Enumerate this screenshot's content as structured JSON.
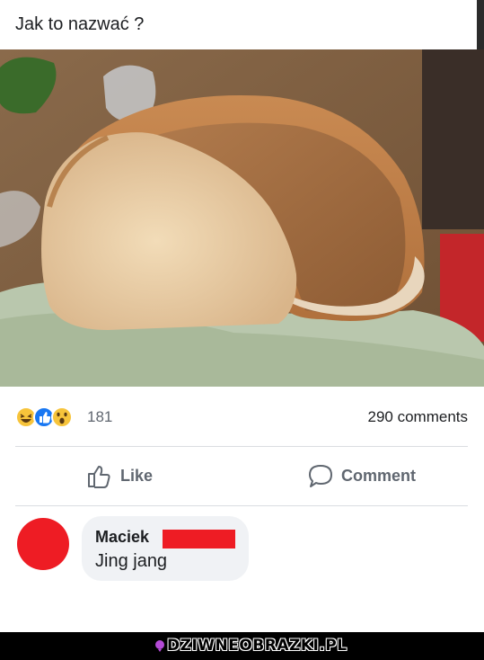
{
  "post": {
    "text": "Jak to nazwać ?"
  },
  "photo": {
    "icon": "bread-loaf-photo"
  },
  "stats": {
    "reactions_count": "181",
    "comments_count": "290 comments",
    "reaction_icons": [
      "haha-icon",
      "like-icon",
      "wow-icon"
    ]
  },
  "actions": {
    "like_label": "Like",
    "comment_label": "Comment"
  },
  "comment": {
    "author": "Maciek",
    "text": "Jing jang"
  },
  "watermark": {
    "text": "DZIWNEOBRAZKI.PL"
  },
  "colors": {
    "redaction": "#ee1c24",
    "like_blue": "#1877f2",
    "reaction_yellow": "#f7c43b",
    "muted": "#606770"
  }
}
